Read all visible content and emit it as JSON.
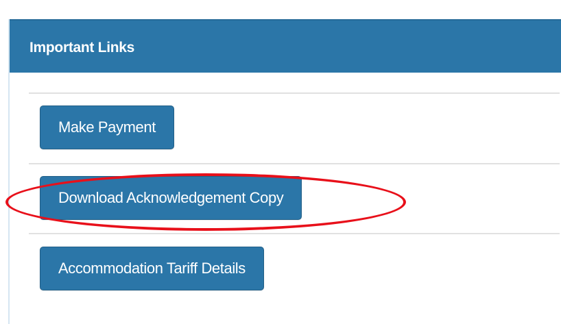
{
  "panel": {
    "title": "Important Links",
    "header_color": "#2b76a8",
    "links": [
      {
        "label": "Make Payment"
      },
      {
        "label": "Download Acknowledgement Copy",
        "highlighted": true
      },
      {
        "label": "Accommodation Tariff Details"
      }
    ]
  },
  "annotation": {
    "shape": "ellipse",
    "color": "#e8101a"
  }
}
